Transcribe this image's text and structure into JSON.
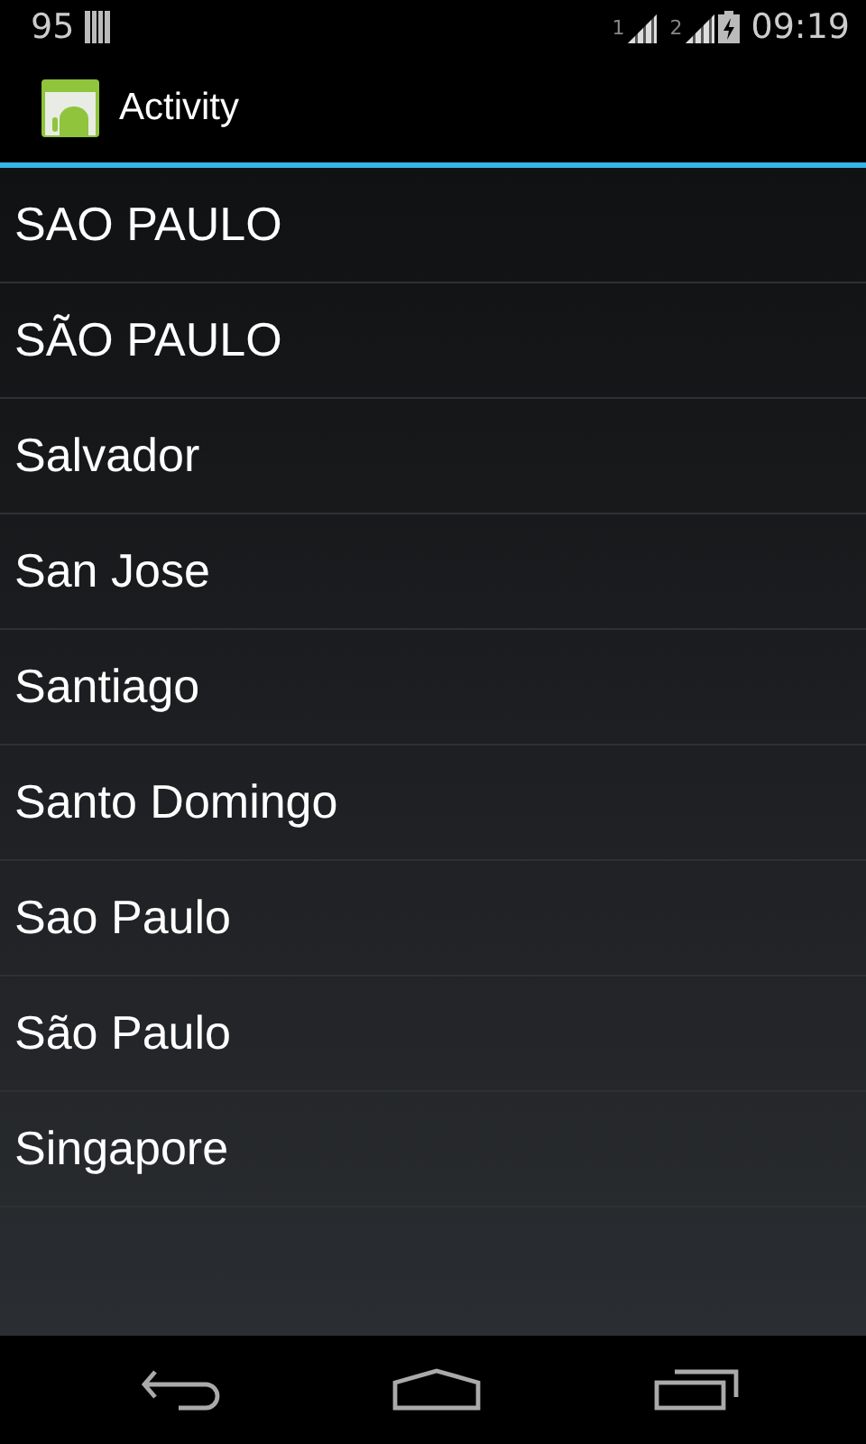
{
  "status_bar": {
    "notification": "95",
    "sim_1": "1",
    "sim_2": "2",
    "time": "09:19"
  },
  "action_bar": {
    "title": "Activity"
  },
  "list": [
    {
      "label": "SAO PAULO"
    },
    {
      "label": "SÃO PAULO"
    },
    {
      "label": "Salvador"
    },
    {
      "label": "San Jose"
    },
    {
      "label": "Santiago"
    },
    {
      "label": "Santo Domingo"
    },
    {
      "label": "Sao Paulo"
    },
    {
      "label": "São Paulo"
    },
    {
      "label": "Singapore"
    }
  ]
}
